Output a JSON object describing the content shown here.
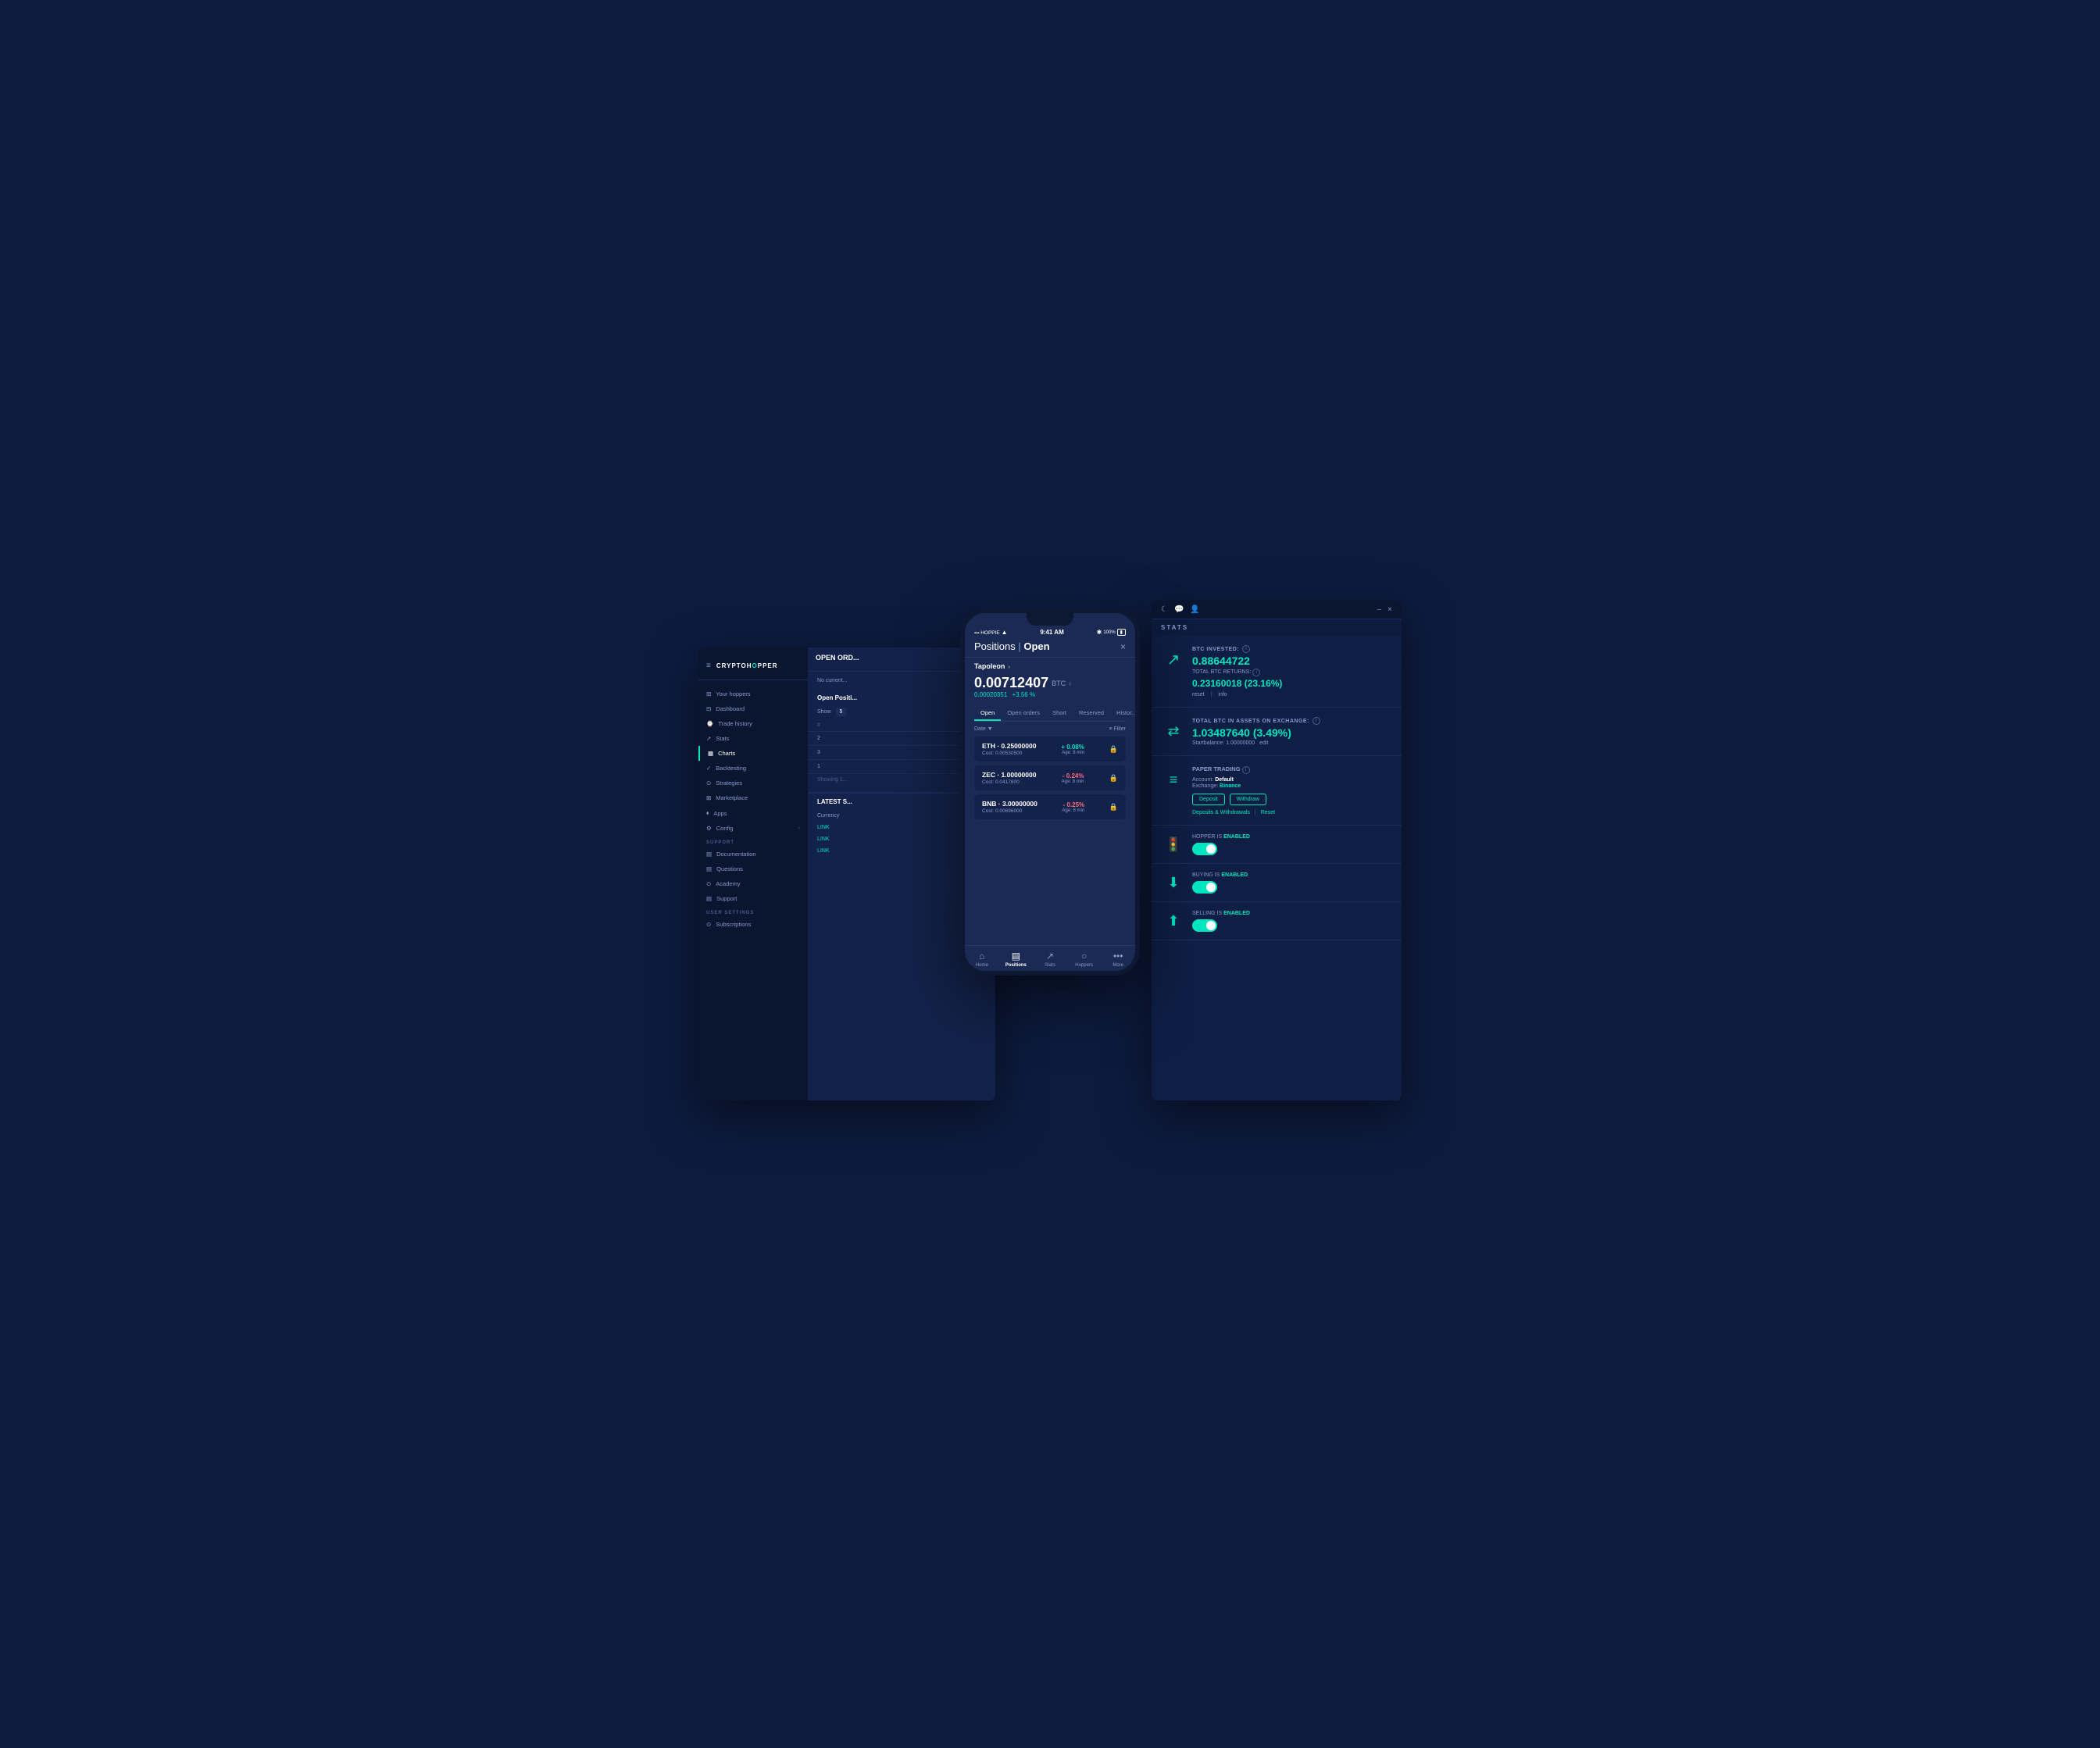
{
  "app": {
    "name": "CRYPTOHOPPER"
  },
  "topbar": {
    "moon_icon": "☾",
    "chat_icon": "💬",
    "user_icon": "👤",
    "minimize": "–",
    "close": "×"
  },
  "sidebar": {
    "logo": "CRYPTOH",
    "logo_accent": "O",
    "logo_rest": "PPER",
    "hamburger": "≡",
    "items": [
      {
        "label": "Your hoppers",
        "icon": "⊞"
      },
      {
        "label": "Dashboard",
        "icon": "⊟"
      },
      {
        "label": "Trade history",
        "icon": "⌚"
      },
      {
        "label": "Stats",
        "icon": "↗"
      },
      {
        "label": "Charts",
        "icon": "▦"
      },
      {
        "label": "Backtesting",
        "icon": "✓"
      },
      {
        "label": "Strategies",
        "icon": "⊙"
      },
      {
        "label": "Marketplace",
        "icon": "⊠"
      },
      {
        "label": "Apps",
        "icon": "⬧"
      },
      {
        "label": "Config",
        "icon": "⚙"
      }
    ],
    "support_section": "SUPPORT",
    "support_items": [
      {
        "label": "Documentation",
        "icon": "▤"
      },
      {
        "label": "Questions",
        "icon": "▤"
      },
      {
        "label": "Academy",
        "icon": "⊙"
      },
      {
        "label": "Support",
        "icon": "▤"
      }
    ],
    "user_settings": "USER SETTINGS",
    "user_items": [
      {
        "label": "Subscriptions",
        "icon": "⊙"
      }
    ]
  },
  "main": {
    "open_orders_title": "OPEN ORD...",
    "no_current": "No current...",
    "open_positions_label": "Open Positi...",
    "show_label": "Show",
    "table_headers": [
      "#",
      ""
    ],
    "table_rows": [
      {
        "num": "2"
      },
      {
        "num": "3"
      },
      {
        "num": "1"
      }
    ],
    "showing_text": "Showing 1...",
    "latest_signals": "LATEST S...",
    "currency_label": "Currency",
    "links": [
      "LINK",
      "LINK",
      "LINK"
    ]
  },
  "stats_panel": {
    "title": "STATS",
    "btc_invested_label": "BTC INVESTED:",
    "btc_invested_value": "0.88644722",
    "total_btc_returns_label": "TOTAL BTC RETURNS:",
    "total_btc_returns_value": "0.23160018 (23.16%)",
    "reset_link": "reset",
    "info_link": "info",
    "total_btc_assets_label": "TOTAL BTC IN ASSETS ON EXCHANGE:",
    "total_btc_assets_value": "1.03487640 (3.49%)",
    "start_balance": "Startbalance: 1.00000000",
    "edit_link": "edit",
    "paper_trading_label": "PAPER TRADING",
    "paper_account_label": "Account:",
    "paper_account_value": "Default",
    "paper_exchange_label": "Exchange:",
    "paper_exchange_value": "Binance",
    "deposit_btn": "Deposit",
    "withdraw_btn": "Withdraw",
    "deposits_withdrawals_link": "Deposits & Withdrawals",
    "reset_link2": "Reset",
    "hopper_enabled_label": "HOPPER IS",
    "hopper_enabled_status": "ENABLED",
    "buying_enabled_label": "BUYING IS",
    "buying_enabled_status": "ENABLED",
    "selling_enabled_label": "SELLING IS",
    "selling_enabled_status": "ENABLED"
  },
  "phone": {
    "carrier": "HOPPIE",
    "time": "9:41 AM",
    "battery": "100%",
    "bluetooth": "✱",
    "wifi": "▲",
    "title_positions": "Positions",
    "title_open": "Open",
    "hopper_name": "Tapoleon",
    "btc_amount": "0.00712407",
    "btc_currency": "BTC",
    "btc_change_base": "0.00020351",
    "btc_change_pct": "+3.56 %",
    "tabs": [
      {
        "label": "Open",
        "active": true
      },
      {
        "label": "Open orders"
      },
      {
        "label": "Short"
      },
      {
        "label": "Reserved"
      },
      {
        "label": "Histor..."
      }
    ],
    "date_sort": "Date",
    "filter_label": "Filter",
    "positions": [
      {
        "coin": "ETH · 0.25000000",
        "cost": "Cost: 0.00530500",
        "change": "+ 0.08%",
        "change_type": "positive",
        "age": "Age: 8 min"
      },
      {
        "coin": "ZEC · 1.00000000",
        "cost": "Cost: 0.0417800",
        "change": "- 0.24%",
        "change_type": "negative",
        "age": "Age: 8 min"
      },
      {
        "coin": "BNB · 3.00000000",
        "cost": "Cost: 0.00696000",
        "change": "- 0.25%",
        "change_type": "negative",
        "age": "Age: 8 min"
      }
    ],
    "nav_items": [
      {
        "label": "Home",
        "icon": "⌂",
        "active": false
      },
      {
        "label": "Positions",
        "icon": "▤",
        "active": true
      },
      {
        "label": "Stats",
        "icon": "↗",
        "active": false
      },
      {
        "label": "Hoppers",
        "icon": "○",
        "active": false
      },
      {
        "label": "More",
        "icon": "•••",
        "active": false
      }
    ]
  }
}
